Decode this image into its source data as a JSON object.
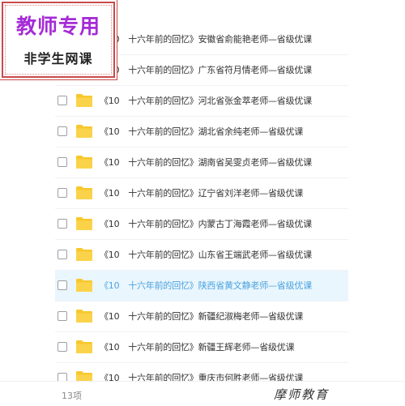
{
  "stamp": {
    "title": "教师专用",
    "subtitle": "非学生网课"
  },
  "file_list": {
    "items": [
      {
        "name": "《10　十六年前的回忆》安徽省俞能艳老师—省级优课",
        "selected": false
      },
      {
        "name": "《10　十六年前的回忆》广东省符月情老师—省级优课",
        "selected": false
      },
      {
        "name": "《10　十六年前的回忆》河北省张金萃老师—省级优课",
        "selected": false
      },
      {
        "name": "《10　十六年前的回忆》湖北省余纯老师—省级优课",
        "selected": false
      },
      {
        "name": "《10　十六年前的回忆》湖南省吴雯贞老师—省级优课",
        "selected": false
      },
      {
        "name": "《10　十六年前的回忆》辽宁省刘洋老师—省级优课",
        "selected": false
      },
      {
        "name": "《10　十六年前的回忆》内蒙古丁海霞老师—省级优课",
        "selected": false
      },
      {
        "name": "《10　十六年前的回忆》山东省王端武老师—省级优课",
        "selected": false
      },
      {
        "name": "《10　十六年前的回忆》陕西省黄文静老师—省级优课",
        "selected": true
      },
      {
        "name": "《10　十六年前的回忆》新疆纪淑梅老师—省级优课",
        "selected": false
      },
      {
        "name": "《10　十六年前的回忆》新疆王辉老师—省级优课",
        "selected": false
      },
      {
        "name": "《10　十六年前的回忆》重庆市何胜老师—省级优课",
        "selected": false
      }
    ]
  },
  "footer": {
    "count": "13项",
    "watermark": "摩师教育"
  },
  "colors": {
    "folder": "#f7c82d",
    "selected_bg": "#eaf6fd",
    "selected_text": "#4aa3df",
    "stamp_title": "#a52bd6",
    "stamp_border": "#c94a4a"
  },
  "icons": {
    "folder": "folder-icon",
    "checkbox": "checkbox"
  }
}
